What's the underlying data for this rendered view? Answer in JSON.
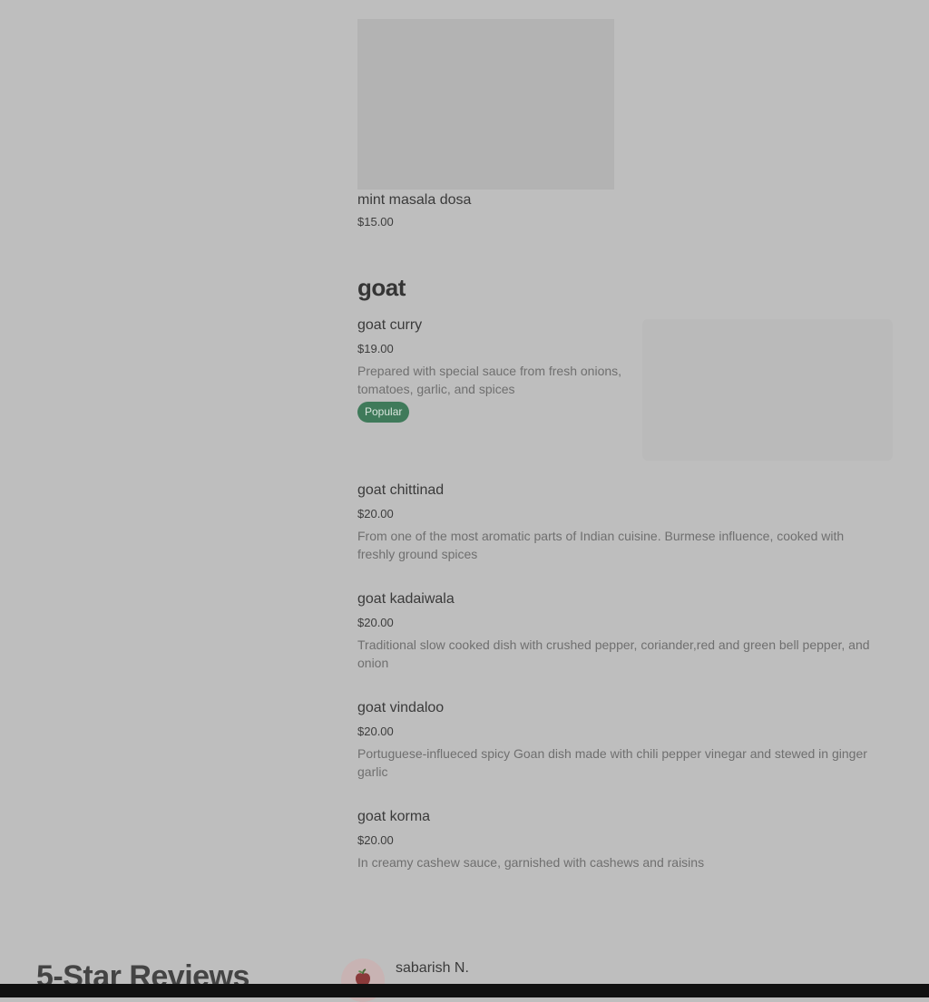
{
  "menu": {
    "top_item": {
      "name": "mint masala dosa",
      "price": "$15.00"
    },
    "section": {
      "title": "goat",
      "items": [
        {
          "name": "goat curry",
          "price": "$19.00",
          "description_lines": [
            "Prepared with special sauce from fresh onions,",
            "tomatoes, garlic, and spices"
          ],
          "badge": "Popular"
        },
        {
          "name": "goat chittinad",
          "price": "$20.00",
          "description_lines": [
            "From one of the most aromatic parts of Indian cuisine. Burmese influence, cooked with",
            "freshly ground spices"
          ]
        },
        {
          "name": "goat kadaiwala",
          "price": "$20.00",
          "description_lines": [
            "Traditional slow cooked dish with crushed pepper, coriander,red and green bell pepper, and",
            "onion"
          ]
        },
        {
          "name": "goat vindaloo",
          "price": "$20.00",
          "description_lines": [
            "Portuguese-influeced spicy Goan dish made with chili pepper vinegar and stewed in ginger",
            "garlic"
          ]
        },
        {
          "name": "goat korma",
          "price": "$20.00",
          "description_lines": [
            "In creamy cashew sauce, garnished with cashews and raisins"
          ]
        }
      ]
    }
  },
  "reviews": {
    "title": "5-Star Reviews",
    "first_reviewer": {
      "name": "sabarish N.",
      "avatar_icon": "apple-icon"
    }
  },
  "colors": {
    "badge": "#3f7a5a",
    "overlay": "#bebebe"
  }
}
